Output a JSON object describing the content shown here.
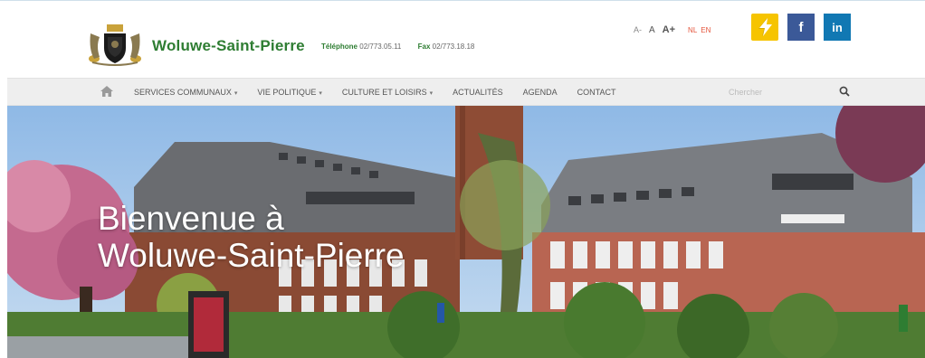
{
  "site": {
    "title": "Woluwe-Saint-Pierre",
    "phone_label": "Téléphone",
    "phone": "02/773.05.11",
    "fax_label": "Fax",
    "fax": "02/773.18.18"
  },
  "tools": {
    "font_small": "A-",
    "font_normal": "A",
    "font_large": "A+",
    "lang_nl": "NL",
    "lang_en": "EN"
  },
  "social": {
    "facebook": "f",
    "linkedin": "in",
    "partner_icon": "lightning-badge-icon"
  },
  "nav": {
    "home_icon": "home-icon",
    "items": [
      {
        "label": "Services communaux",
        "dropdown": true
      },
      {
        "label": "Vie politique",
        "dropdown": true
      },
      {
        "label": "Culture et loisirs",
        "dropdown": true
      },
      {
        "label": "Actualités",
        "dropdown": false
      },
      {
        "label": "Agenda",
        "dropdown": false
      },
      {
        "label": "Contact",
        "dropdown": false
      }
    ],
    "caret": "▾",
    "search_placeholder": "Chercher",
    "search_icon": "search-icon"
  },
  "hero": {
    "line1": "Bienvenue à",
    "line2": "Woluwe-Saint-Pierre"
  },
  "colors": {
    "brand_green": "#2e7d32",
    "lang_red": "#e4543b",
    "facebook": "#3b5998",
    "linkedin": "#1178b3",
    "partner_yellow": "#f6c400"
  }
}
